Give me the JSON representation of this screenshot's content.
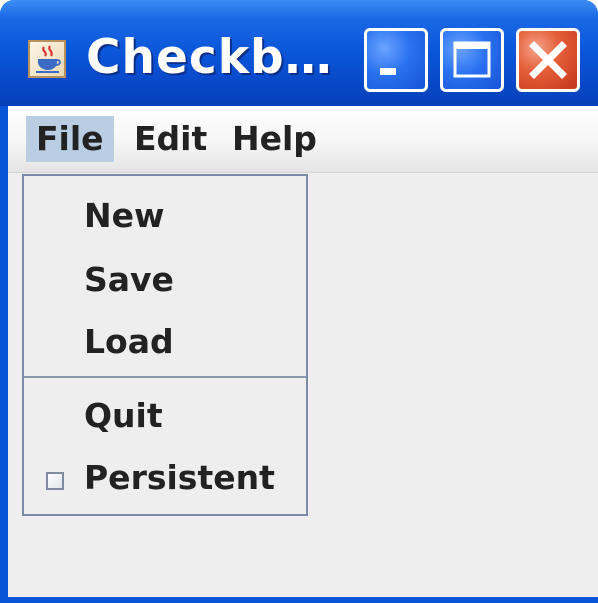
{
  "window": {
    "title": "Checkb…",
    "icon": "java-coffee-icon",
    "controls": [
      "minimize-icon",
      "maximize-icon",
      "close-icon"
    ]
  },
  "menubar": {
    "items": [
      {
        "label": "File",
        "active": true
      },
      {
        "label": "Edit",
        "active": false
      },
      {
        "label": "Help",
        "active": false
      }
    ]
  },
  "file_menu": {
    "items": [
      {
        "label": "New"
      },
      {
        "label": "Save"
      },
      {
        "label": "Load"
      },
      {
        "label": "Quit"
      },
      {
        "label": "Persistent",
        "type": "checkbox",
        "checked": false
      }
    ]
  },
  "colors": {
    "titlebar": "#0a54d8",
    "menu_highlight": "#b9cde3",
    "close_button": "#d44a2a"
  }
}
